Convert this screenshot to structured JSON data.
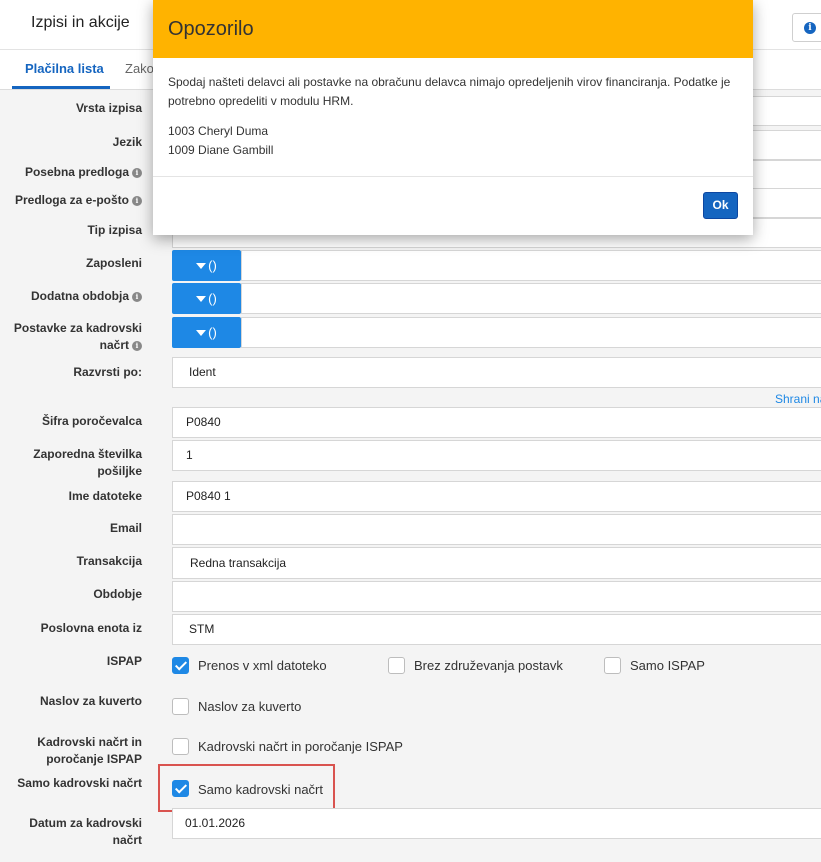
{
  "header": {
    "title": "Izpisi in akcije",
    "info_icon": "info-circle-icon"
  },
  "tabs": [
    {
      "label": "Plačilna lista",
      "active": true
    },
    {
      "label": "Zako",
      "active": false
    }
  ],
  "form": {
    "vrsta_izpisa": {
      "label": "Vrsta izpisa"
    },
    "jezik": {
      "label": "Jezik"
    },
    "posebna_predloga": {
      "label": "Posebna predloga"
    },
    "predloga_eposta": {
      "label": "Predloga za e-pošto"
    },
    "tip_izpisa": {
      "label": "Tip izpisa"
    },
    "zaposleni": {
      "label": "Zaposleni",
      "button": "()"
    },
    "dodatna_obdobja": {
      "label": "Dodatna obdobja",
      "button": "()"
    },
    "postavke": {
      "label": "Postavke za kadrovski načrt",
      "button": "()"
    },
    "razvrsti_po": {
      "label": "Razvrsti po:",
      "value": "Ident"
    },
    "shrani_link": "Shrani na",
    "sifra_porocevalca": {
      "label": "Šifra poročevalca",
      "value": "P0840"
    },
    "zaporedna_stevilka": {
      "label": "Zaporedna številka pošiljke",
      "value": "1"
    },
    "ime_datoteke": {
      "label": "Ime datoteke",
      "value": "P0840 1"
    },
    "email": {
      "label": "Email",
      "value": ""
    },
    "transakcija": {
      "label": "Transakcija",
      "value": "Redna transakcija"
    },
    "obdobje": {
      "label": "Obdobje",
      "value": ""
    },
    "poslovna_enota": {
      "label": "Poslovna enota iz",
      "value": "STM"
    },
    "ispap": {
      "label": "ISPAP",
      "options": [
        {
          "label": "Prenos v xml datoteko",
          "checked": true
        },
        {
          "label": "Brez združevanja postavk",
          "checked": false
        },
        {
          "label": "Samo ISPAP",
          "checked": false
        }
      ]
    },
    "naslov_kuverto": {
      "label": "Naslov za kuverto",
      "checkbox": "Naslov za kuverto",
      "checked": false
    },
    "kadrovski_ispap": {
      "label": "Kadrovski načrt in poročanje ISPAP",
      "checkbox": "Kadrovski načrt in poročanje ISPAP",
      "checked": false
    },
    "samo_kadrovski": {
      "label": "Samo kadrovski načrt",
      "checkbox": "Samo kadrovski načrt",
      "checked": true
    },
    "datum_kadrovski": {
      "label": "Datum za kadrovski načrt",
      "value": "01.01.2026"
    }
  },
  "modal": {
    "title": "Opozorilo",
    "message": "Spodaj našteti delavci ali postavke na obračunu delavca nimajo opredeljenih virov financiranja. Podatke je potrebno opredeliti v modulu HRM.",
    "employees": [
      "1003 Cheryl Duma",
      "1009 Diane Gambill"
    ],
    "ok_label": "Ok",
    "header_color": "#ffb300"
  },
  "colors": {
    "accent": "#1e88e5",
    "tab_active": "#1565c0",
    "highlight": "#d9534f"
  }
}
